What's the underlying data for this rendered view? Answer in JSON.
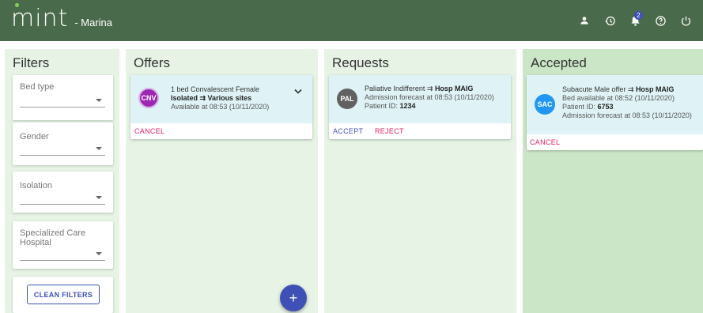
{
  "header": {
    "logo_text": "mint",
    "user_label": "- Marina",
    "notification_count": "2"
  },
  "filters": {
    "title": "Filters",
    "bed_type_label": "Bed type",
    "gender_label": "Gender",
    "isolation_label": "Isolation",
    "specialized_label": "Specialized Care Hospital",
    "clean_button": "CLEAN FILTERS"
  },
  "offers": {
    "title": "Offers",
    "card": {
      "avatar": "CNV",
      "avatar_color": "#9c27b0",
      "line1": "1 bed Convalescent Female",
      "line2_bold": "Isolated ⇉ Various sites",
      "line3": "Available at 08:53 (10/11/2020)",
      "cancel": "CANCEL"
    }
  },
  "requests": {
    "title": "Requests",
    "card": {
      "avatar": "PAL",
      "avatar_color": "#616161",
      "line1_prefix": "Paliative Indifferent ⇉ ",
      "line1_bold": "Hosp MAIG",
      "line2": "Admission forecast at 08:53 (10/11/2020)",
      "line3_prefix": "Patient ID: ",
      "line3_bold": "1234",
      "accept": "ACCEPT",
      "reject": "REJECT"
    }
  },
  "accepted": {
    "title": "Accepted",
    "card": {
      "avatar": "SAC",
      "avatar_color": "#2196f3",
      "line1_prefix": "Subacute Male offer ⇉ ",
      "line1_bold": "Hosp MAIG",
      "line2": "Bed available at 08:52 (10/11/2020)",
      "line3_prefix": "Patient ID: ",
      "line3_bold": "6753",
      "line4": "Admission forecast at 08:53 (10/11/2020)",
      "cancel": "CANCEL"
    }
  },
  "fab_label": "+",
  "colors": {
    "topbar": "#4a6b4b",
    "accent": "#3f51b5",
    "action_red": "#e91e63"
  }
}
